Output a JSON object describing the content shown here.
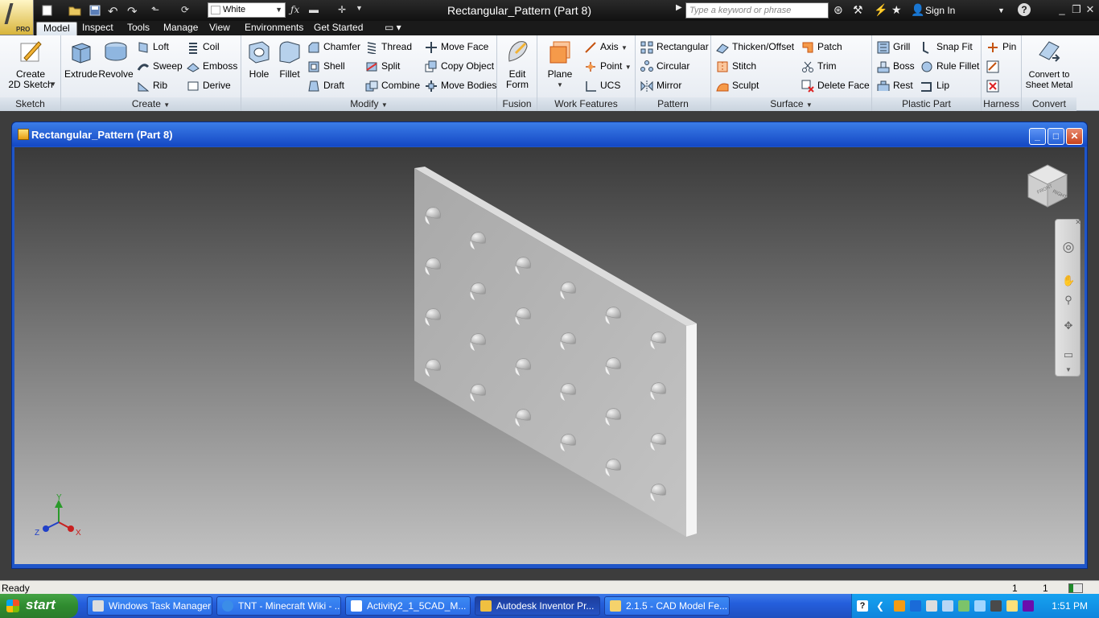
{
  "title_bar": {
    "window_title": "Rectangular_Pattern (Part 8)",
    "style_value": "White",
    "search_placeholder": "Type a keyword or phrase",
    "sign_in": "Sign In",
    "app_badge": "PRO",
    "help_label": "?"
  },
  "tabs": [
    "Model",
    "Inspect",
    "Tools",
    "Manage",
    "View",
    "Environments",
    "Get Started"
  ],
  "active_tab": "Model",
  "ribbon": {
    "sketch": {
      "title": "Sketch",
      "create_2d_sketch": "Create\n2D Sketch"
    },
    "create": {
      "title": "Create",
      "extrude": "Extrude",
      "revolve": "Revolve",
      "loft": "Loft",
      "sweep": "Sweep",
      "rib": "Rib",
      "coil": "Coil",
      "emboss": "Emboss",
      "derive": "Derive"
    },
    "modify": {
      "title": "Modify",
      "hole": "Hole",
      "fillet": "Fillet",
      "chamfer": "Chamfer",
      "shell": "Shell",
      "draft": "Draft",
      "thread": "Thread",
      "split": "Split",
      "combine": "Combine",
      "move_face": "Move Face",
      "copy_object": "Copy Object",
      "move_bodies": "Move Bodies"
    },
    "fusion": {
      "title": "Fusion",
      "edit_form": "Edit\nForm"
    },
    "work_features": {
      "title": "Work Features",
      "plane": "Plane",
      "axis": "Axis",
      "point": "Point",
      "ucs": "UCS"
    },
    "pattern": {
      "title": "Pattern",
      "rectangular": "Rectangular",
      "circular": "Circular",
      "mirror": "Mirror"
    },
    "surface": {
      "title": "Surface",
      "thicken_offset": "Thicken/Offset",
      "stitch": "Stitch",
      "sculpt": "Sculpt",
      "patch": "Patch",
      "trim": "Trim",
      "delete_face": "Delete Face"
    },
    "plastic_part": {
      "title": "Plastic Part",
      "grill": "Grill",
      "boss": "Boss",
      "rest": "Rest",
      "snap_fit": "Snap Fit",
      "rule_fillet": "Rule Fillet",
      "lip": "Lip"
    },
    "harness": {
      "title": "Harness",
      "pin": "Pin"
    },
    "convert": {
      "title": "Convert",
      "convert_to_sheet_metal": "Convert to\nSheet Metal"
    }
  },
  "document": {
    "title": "Rectangular_Pattern (Part 8)",
    "viewcube_front": "FRONT",
    "viewcube_right": "RIGHT",
    "triad": {
      "x": "X",
      "y": "Y",
      "z": "Z"
    }
  },
  "status": {
    "text": "Ready",
    "count1": "1",
    "count2": "1"
  },
  "taskbar": {
    "start": "start",
    "tasks": [
      "Windows Task Manager",
      "TNT - Minecraft Wiki - ...",
      "Activity2_1_5CAD_M...",
      "Autodesk Inventor Pr...",
      "2.1.5 - CAD Model Fe..."
    ],
    "active_task": 3,
    "clock": "1:51 PM"
  },
  "colors": {
    "title_bar": "#1a1a1a",
    "ribbon": "#eef2f7",
    "doc_frame": "#1f56c9",
    "taskbar": "#245edc",
    "start": "#2f8b2f"
  }
}
